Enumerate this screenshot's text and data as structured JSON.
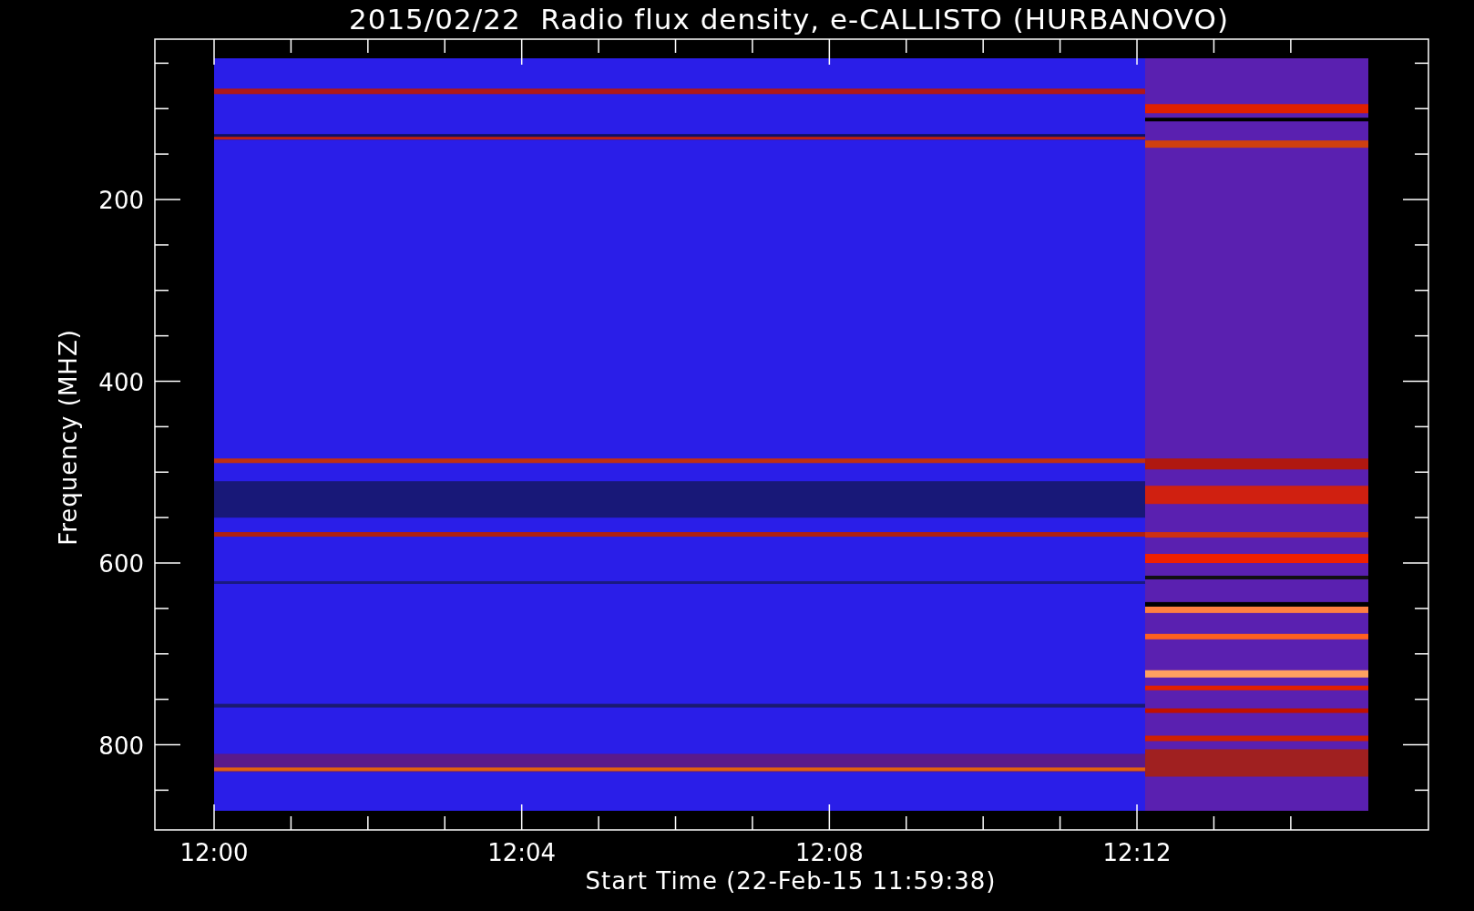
{
  "title": "2015/02/22  Radio flux density, e-CALLISTO (HURBANOVO)",
  "y_axis": {
    "label": "Frequency (MHZ)",
    "ticks": [
      "200",
      "400",
      "600",
      "800"
    ]
  },
  "x_axis": {
    "label": "Start Time (22-Feb-15 11:59:38)",
    "ticks": [
      "12:00",
      "12:04",
      "12:08",
      "12:12"
    ]
  }
}
